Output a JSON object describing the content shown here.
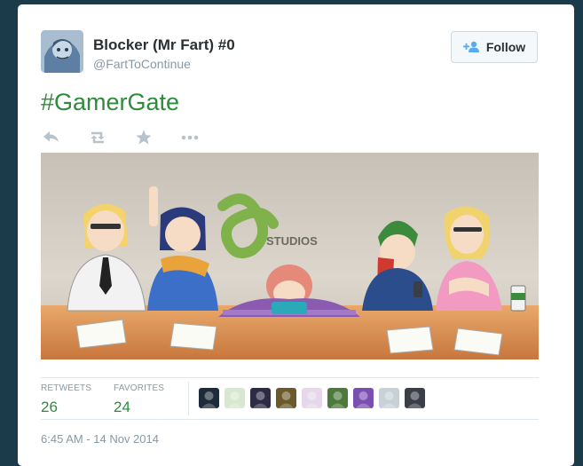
{
  "tweet": {
    "author_name": "Blocker (Mr Fart) #0",
    "author_handle": "@FartToContinue",
    "text": "#GamerGate",
    "follow_label": "Follow",
    "media_logo_text": "STUDIOS",
    "timestamp": "6:45 AM - 14 Nov 2014"
  },
  "actions": [
    {
      "name": "reply-icon"
    },
    {
      "name": "retweet-icon"
    },
    {
      "name": "favorite-star-icon"
    },
    {
      "name": "more-options-icon"
    }
  ],
  "stats": {
    "retweets_label": "RETWEETS",
    "retweets_value": "26",
    "favorites_label": "FAVORITES",
    "favorites_value": "24"
  },
  "favoriter_avatars": [
    {
      "color": "#1e2b3a"
    },
    {
      "color": "#d8e8d0"
    },
    {
      "color": "#2c2a45"
    },
    {
      "color": "#6a5a2a"
    },
    {
      "color": "#e6d8ea"
    },
    {
      "color": "#4c7a3a"
    },
    {
      "color": "#7b4fb0"
    },
    {
      "color": "#c8d0d8"
    },
    {
      "color": "#3a3f47"
    }
  ],
  "colors": {
    "hashtag": "#2e8b3c",
    "stat_value": "#2e8b3c",
    "muted_text": "#8899a6",
    "follow_icon": "#55acee"
  }
}
